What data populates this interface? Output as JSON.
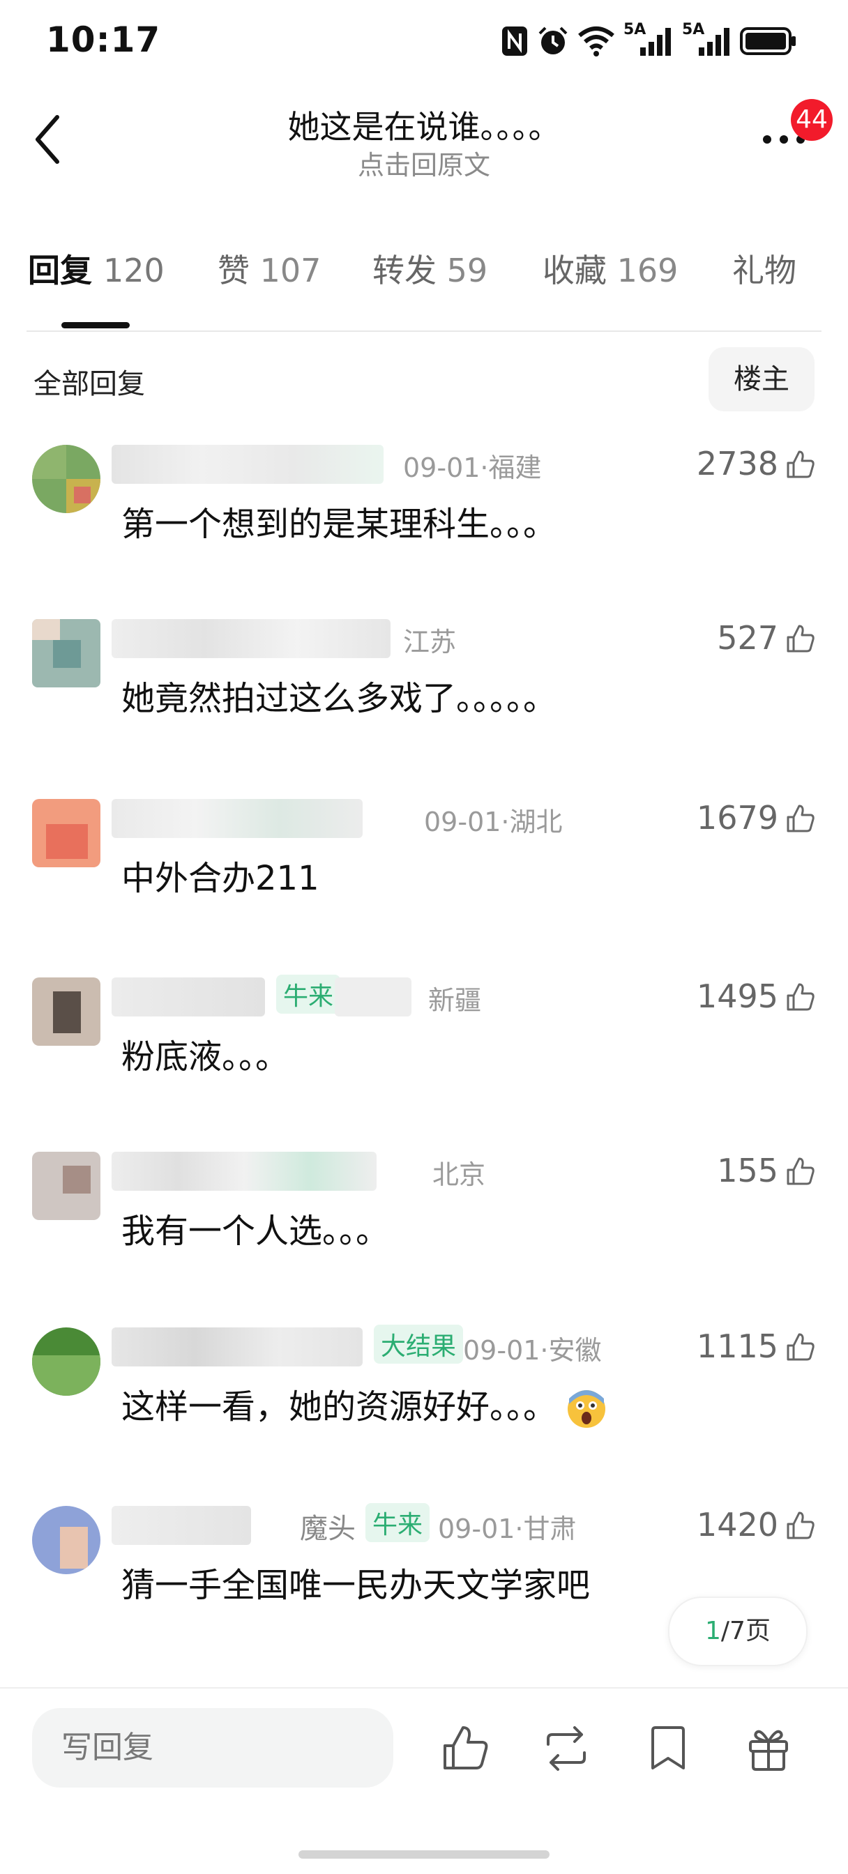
{
  "status_bar": {
    "time": "10:17",
    "network_1": "5A",
    "network_2": "5A",
    "icons": [
      "nfc-icon",
      "alarm-icon",
      "wifi-icon",
      "signal-icon",
      "signal-icon",
      "battery-icon"
    ]
  },
  "header": {
    "title": "她这是在说谁。。。。",
    "subtitle": "点击回原文",
    "notification_count": "44"
  },
  "tabs": [
    {
      "label": "回复",
      "count": "120",
      "active": true
    },
    {
      "label": "赞",
      "count": "107",
      "active": false
    },
    {
      "label": "转发",
      "count": "59",
      "active": false
    },
    {
      "label": "收藏",
      "count": "169",
      "active": false
    },
    {
      "label": "礼物",
      "count": "",
      "active": false
    }
  ],
  "filter": {
    "all_replies": "全部回复",
    "owner_only": "楼主"
  },
  "comments": [
    {
      "meta": "09-01·福建",
      "tag": "",
      "likes": "2738",
      "text": "第一个想到的是某理科生。。。"
    },
    {
      "meta": "江苏",
      "tag": "",
      "likes": "527",
      "text": "她竟然拍过这么多戏了。。。。。"
    },
    {
      "meta": "09-01·湖北",
      "tag": "",
      "likes": "1679",
      "text": "中外合办211"
    },
    {
      "meta": "新疆",
      "tag": "牛来",
      "likes": "1495",
      "text": "粉底液。。。"
    },
    {
      "meta": "北京",
      "tag": "",
      "likes": "155",
      "text": "我有一个人选。。。"
    },
    {
      "meta": "09-01·安徽",
      "tag": "大结果",
      "likes": "1115",
      "text": "这样一看，她的资源好好。。。"
    },
    {
      "meta": "09-01·甘肃",
      "tag": "牛来",
      "username": "魔头",
      "likes": "1420",
      "text": "猜一手全国唯一民办天文学家吧"
    }
  ],
  "pager": {
    "current": "1",
    "total_label": "/7页"
  },
  "bottom_bar": {
    "reply_placeholder": "写回复"
  },
  "colors": {
    "accent_green": "#2bad72",
    "badge_red": "#f21b2b"
  }
}
